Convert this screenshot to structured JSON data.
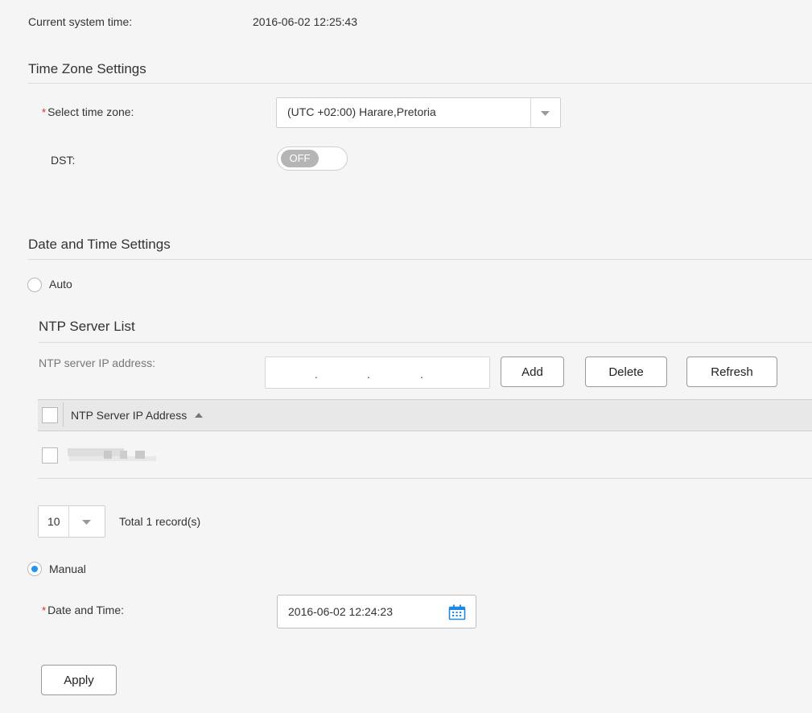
{
  "system_time": {
    "label": "Current system time:",
    "value": "2016-06-02 12:25:43"
  },
  "timezone_section": {
    "title": "Time Zone Settings",
    "select_label": "Select time zone:",
    "select_value": "(UTC +02:00) Harare,Pretoria",
    "dst_label": "DST:",
    "dst_state": "OFF"
  },
  "datetime_section": {
    "title": "Date and Time Settings",
    "auto_label": "Auto",
    "ntp": {
      "title": "NTP Server List",
      "ip_label": "NTP server IP address:",
      "ip_dots": [
        ".",
        ".",
        "."
      ],
      "buttons": {
        "add": "Add",
        "delete": "Delete",
        "refresh": "Refresh"
      },
      "table_header": "NTP Server IP Address",
      "page_size": "10",
      "total_text": "Total 1 record(s)"
    },
    "manual_label": "Manual",
    "datetime_label": "Date and Time:",
    "datetime_value": "2016-06-02 12:24:23",
    "selected_mode": "manual"
  },
  "apply_label": "Apply",
  "colors": {
    "accent": "#2196f3",
    "required": "#e02020",
    "background": "#f5f5f5"
  }
}
